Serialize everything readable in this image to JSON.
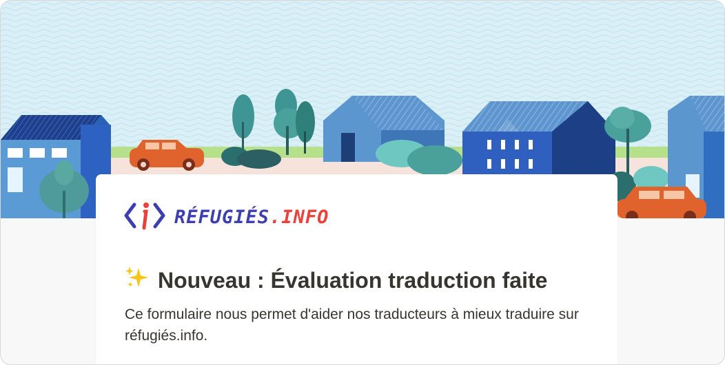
{
  "logo": {
    "brand_main": "RÉFUGIÉS",
    "brand_dot": ".",
    "brand_tld": "INFO"
  },
  "form": {
    "title": "Nouveau : Évaluation traduction faite",
    "description": "Ce formulaire nous permet d'aider nos traducteurs à mieux traduire sur réfugiés.info."
  },
  "icons": {
    "title_icon": "sparkles-icon",
    "logo_icon": "info-brackets-logo-icon"
  },
  "colors": {
    "brand_blue": "#3d3fb0",
    "brand_red": "#e8423a",
    "sky": "#dcf0f8",
    "text": "#37352f"
  }
}
